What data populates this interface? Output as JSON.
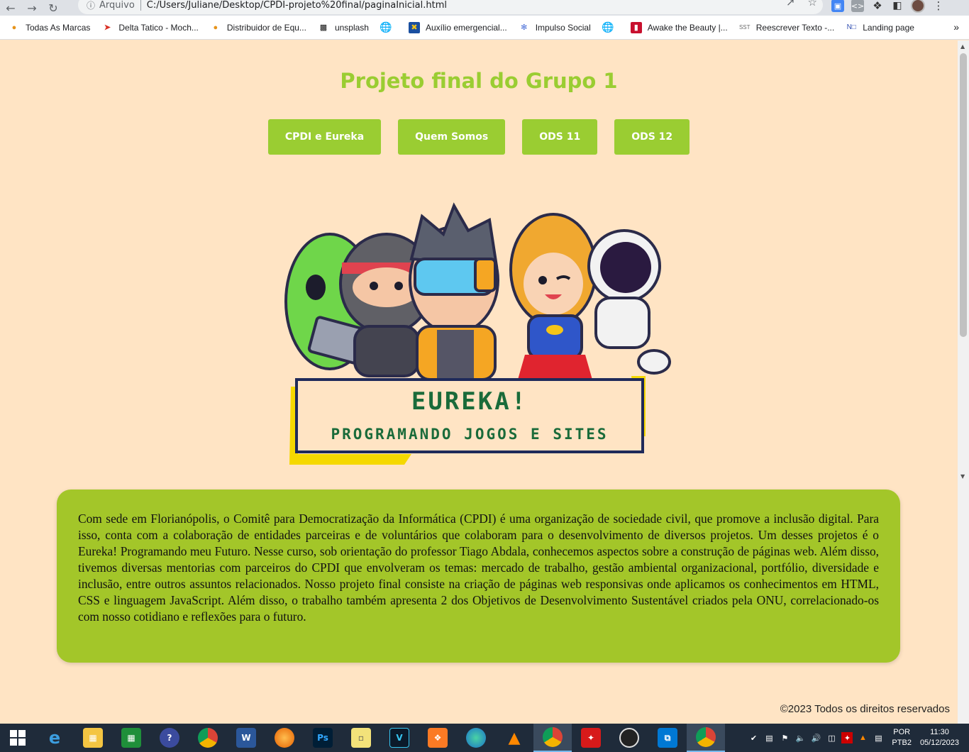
{
  "browser": {
    "scheme_label": "Arquivo",
    "url": "C:/Users/Juliane/Desktop/CPDI-projeto%20final/paginaInicial.html",
    "bookmarks": [
      {
        "label": "Todas As Marcas"
      },
      {
        "label": "Delta Tatico - Moch..."
      },
      {
        "label": "Distribuidor de Equ..."
      },
      {
        "label": "unsplash"
      },
      {
        "label": ""
      },
      {
        "label": "Auxílio emergencial..."
      },
      {
        "label": "Impulso Social"
      },
      {
        "label": ""
      },
      {
        "label": "Awake the Beauty |..."
      },
      {
        "label": "Reescrever Texto -..."
      },
      {
        "label": "Landing page"
      }
    ],
    "more": "»"
  },
  "page": {
    "title": "Projeto final do Grupo 1",
    "nav": [
      {
        "label": "CPDI e Eureka"
      },
      {
        "label": "Quem Somos"
      },
      {
        "label": "ODS 11"
      },
      {
        "label": "ODS 12"
      }
    ],
    "hero": {
      "line1": "EUREKA!",
      "line2": "PROGRAMANDO JOGOS E SITES"
    },
    "description": "Com sede em Florianópolis, o Comitê para Democratização da Informática (CPDI) é uma organização de sociedade civil, que promove a inclusão digital. Para isso, conta com a colaboração de entidades parceiras e de voluntários que colaboram para o desenvolvimento de diversos projetos. Um desses projetos é o Eureka! Programando meu Futuro. Nesse curso, sob orientação do professor Tiago Abdala, conhecemos aspectos sobre a construção de páginas web. Além disso, tivemos diversas mentorias com parceiros do CPDI que envolveram os temas: mercado de trabalho, gestão ambiental organizacional, portfólio, diversidade e inclusão, entre outros assuntos relacionados. Nosso projeto final consiste na criação de páginas web responsivas onde aplicamos os conhecimentos em HTML, CSS e linguagem JavaScript. Além disso, o trabalho também apresenta 2 dos Objetivos de Desenvolvimento Sustentável criados pela ONU, correlacionado-os com nosso cotidiano e reflexões para o futuro.",
    "footer": "©2023 Todos os direitos reservados"
  },
  "taskbar": {
    "lang_top": "POR",
    "lang_bottom": "PTB2",
    "time": "11:30",
    "date": "05/12/2023"
  },
  "colors": {
    "background": "#ffe4c4",
    "accent": "#9acd32",
    "panel": "#a3c629"
  }
}
